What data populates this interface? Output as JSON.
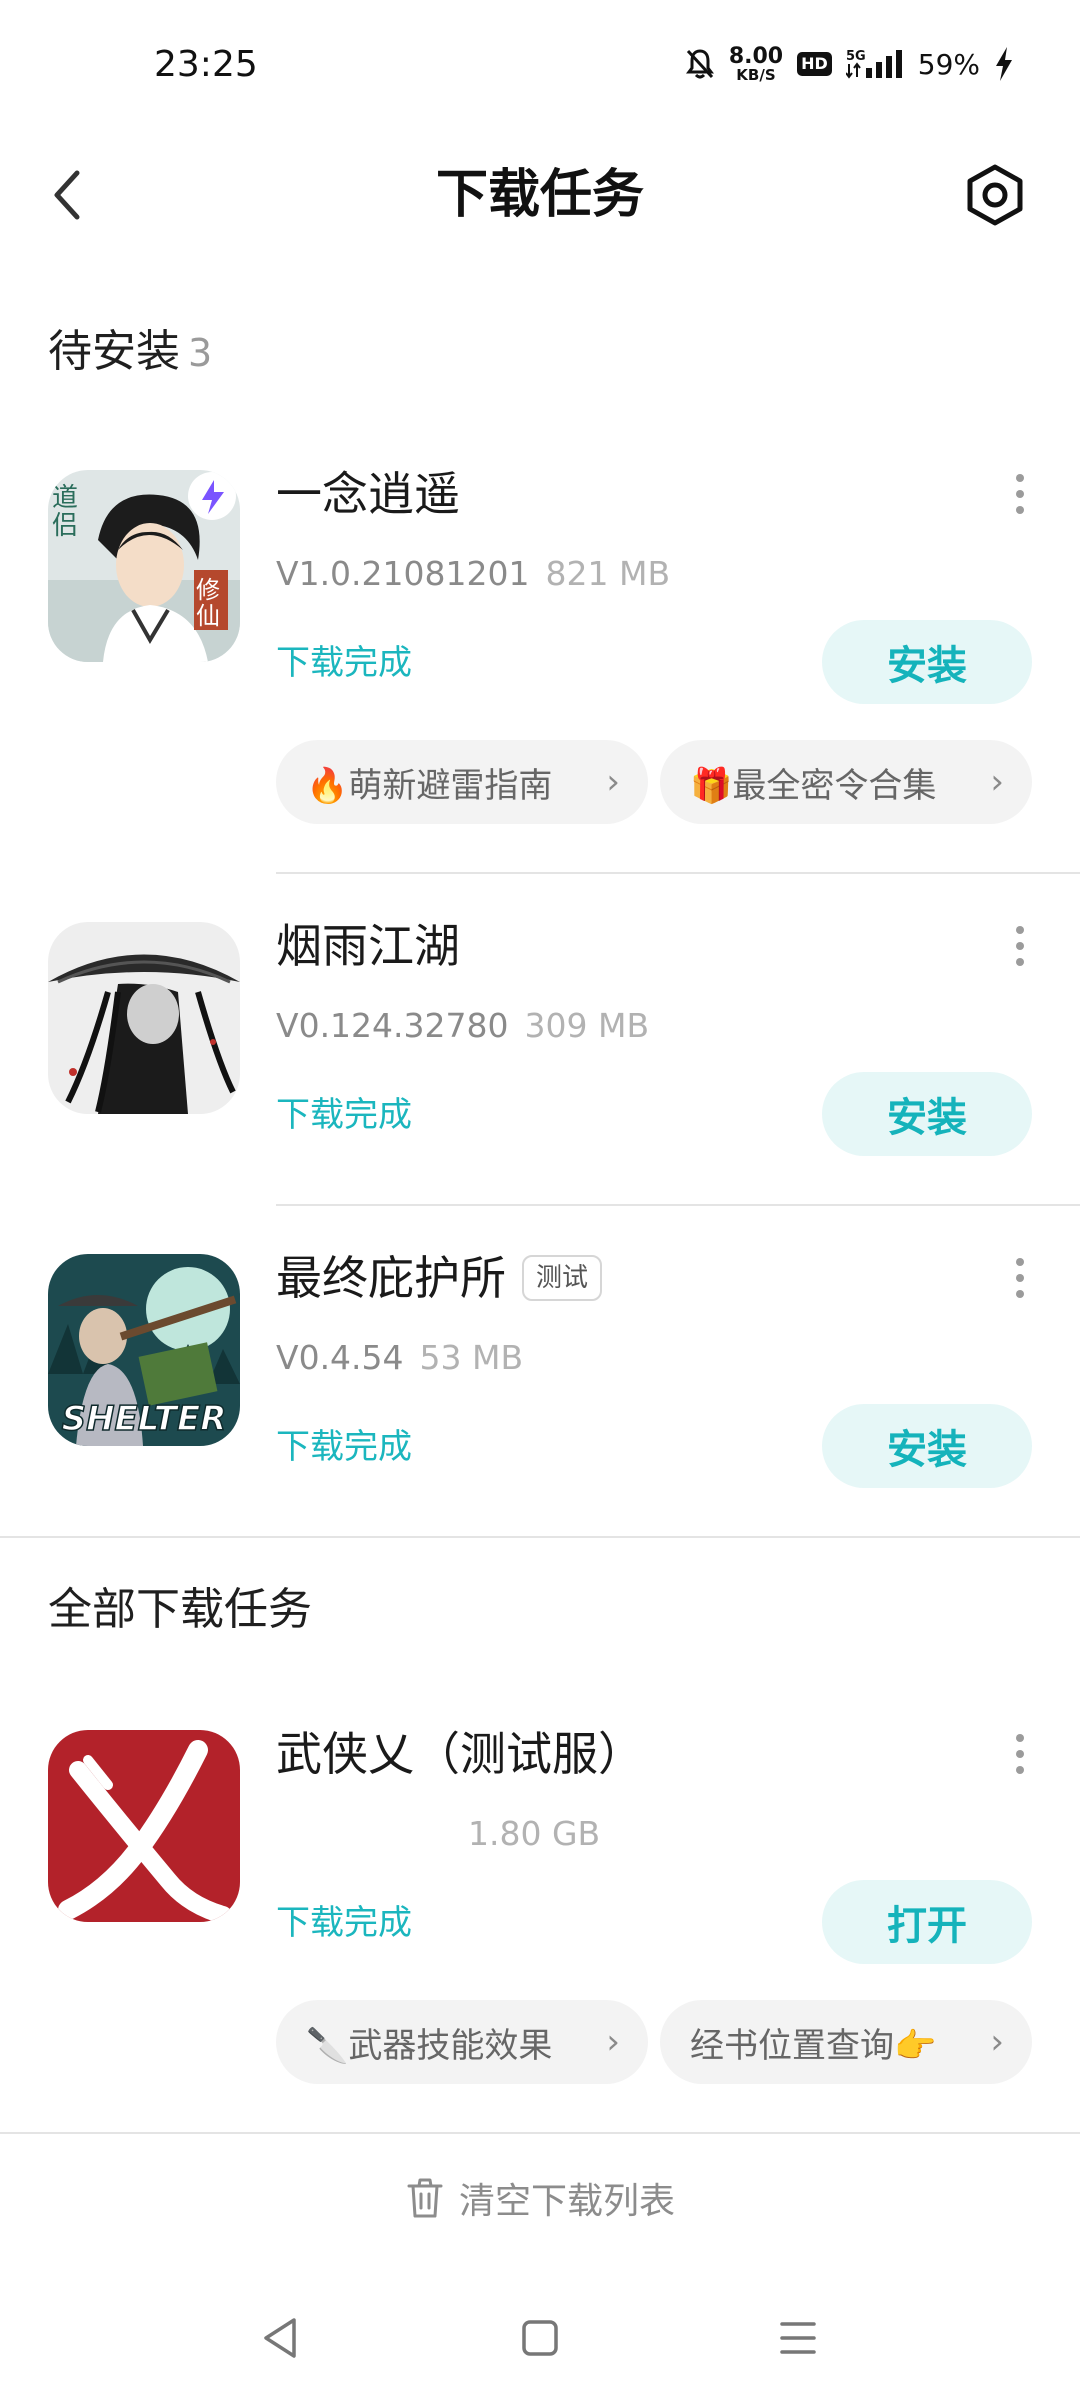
{
  "status_bar": {
    "time": "23:25",
    "net_speed_value": "8.00",
    "net_speed_unit": "KB/S",
    "hd": "HD",
    "network": "5G",
    "battery": "59%"
  },
  "header": {
    "title": "下载任务"
  },
  "pending_section": {
    "title": "待安装",
    "count": "3",
    "items": [
      {
        "name": "一念逍遥",
        "version": "V1.0.21081201",
        "size": "821 MB",
        "status": "下载完成",
        "action": "安装",
        "chips": [
          {
            "label": "🔥萌新避雷指南"
          },
          {
            "label": "🎁最全密令合集"
          }
        ]
      },
      {
        "name": "烟雨江湖",
        "version": "V0.124.32780",
        "size": "309 MB",
        "status": "下载完成",
        "action": "安装"
      },
      {
        "name": "最终庇护所",
        "tag": "测试",
        "version": "V0.4.54",
        "size": "53 MB",
        "status": "下载完成",
        "action": "安装",
        "icon_text": "SHELTER"
      }
    ]
  },
  "all_section": {
    "title": "全部下载任务",
    "items": [
      {
        "name": "武侠乂（测试服）",
        "size": "1.80 GB",
        "status": "下载完成",
        "action": "打开",
        "chips": [
          {
            "label": "🔪武器技能效果"
          },
          {
            "label": "经书位置查询👉"
          }
        ]
      }
    ]
  },
  "footer": {
    "clear_label": "清空下载列表"
  },
  "colors": {
    "accent": "#15b3bb",
    "accent_bg": "#e6f7f7",
    "chip_bg": "#f3f3f3"
  }
}
